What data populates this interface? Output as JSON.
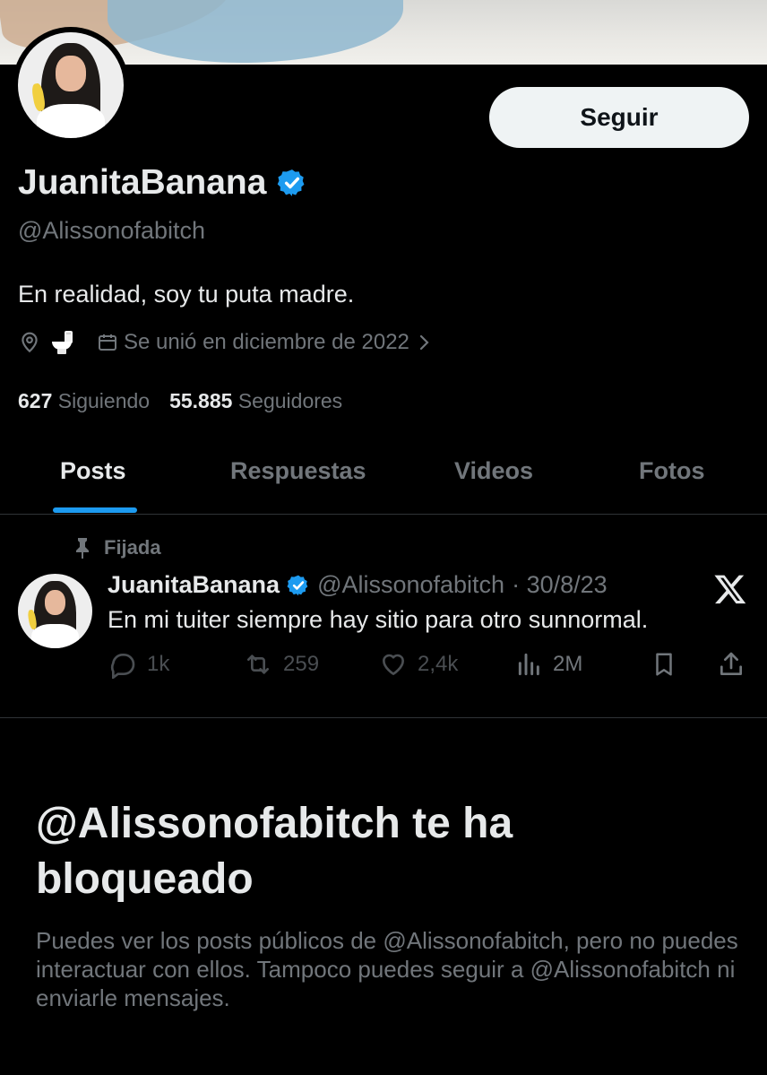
{
  "profile": {
    "display_name": "JuanitaBanana",
    "handle": "@Alissonofabitch",
    "bio": "En realidad, soy tu puta madre.",
    "joined": "Se unió en diciembre de 2022",
    "follow_label": "Seguir",
    "verified_color": "#1d9bf0"
  },
  "stats": {
    "following_count": "627",
    "following_label": "Siguiendo",
    "followers_count": "55.885",
    "followers_label": "Seguidores"
  },
  "tabs": [
    {
      "label": "Posts",
      "active": true
    },
    {
      "label": "Respuestas",
      "active": false
    },
    {
      "label": "Videos",
      "active": false
    },
    {
      "label": "Fotos",
      "active": false
    }
  ],
  "pinned_post": {
    "pinned_label": "Fijada",
    "author_name": "JuanitaBanana",
    "author_handle": "@Alissonofabitch",
    "date": "· 30/8/23",
    "text": "En mi tuiter siempre hay sitio para otro sunnormal.",
    "replies": "1k",
    "reposts": "259",
    "likes": "2,4k",
    "views": "2M"
  },
  "blocked": {
    "title": "@Alissonofabitch te ha bloqueado",
    "description": "Puedes ver los posts públicos de @Alissonofabitch, pero no puedes interactuar con ellos. Tampoco puedes seguir a @Alissonofabitch ni enviarle mensajes."
  },
  "icons": {
    "location": "location-pin-icon",
    "toilet": "toilet-emoji",
    "calendar": "calendar-icon",
    "pin": "pin-icon",
    "reply": "reply-icon",
    "repost": "repost-icon",
    "like": "heart-icon",
    "views": "views-chart-icon",
    "bookmark": "bookmark-icon",
    "share": "share-icon",
    "x_logo": "x-logo-icon"
  },
  "colors": {
    "accent": "#1d9bf0",
    "background": "#000000",
    "text_primary": "#e7e9ea",
    "text_secondary": "#71767b"
  }
}
